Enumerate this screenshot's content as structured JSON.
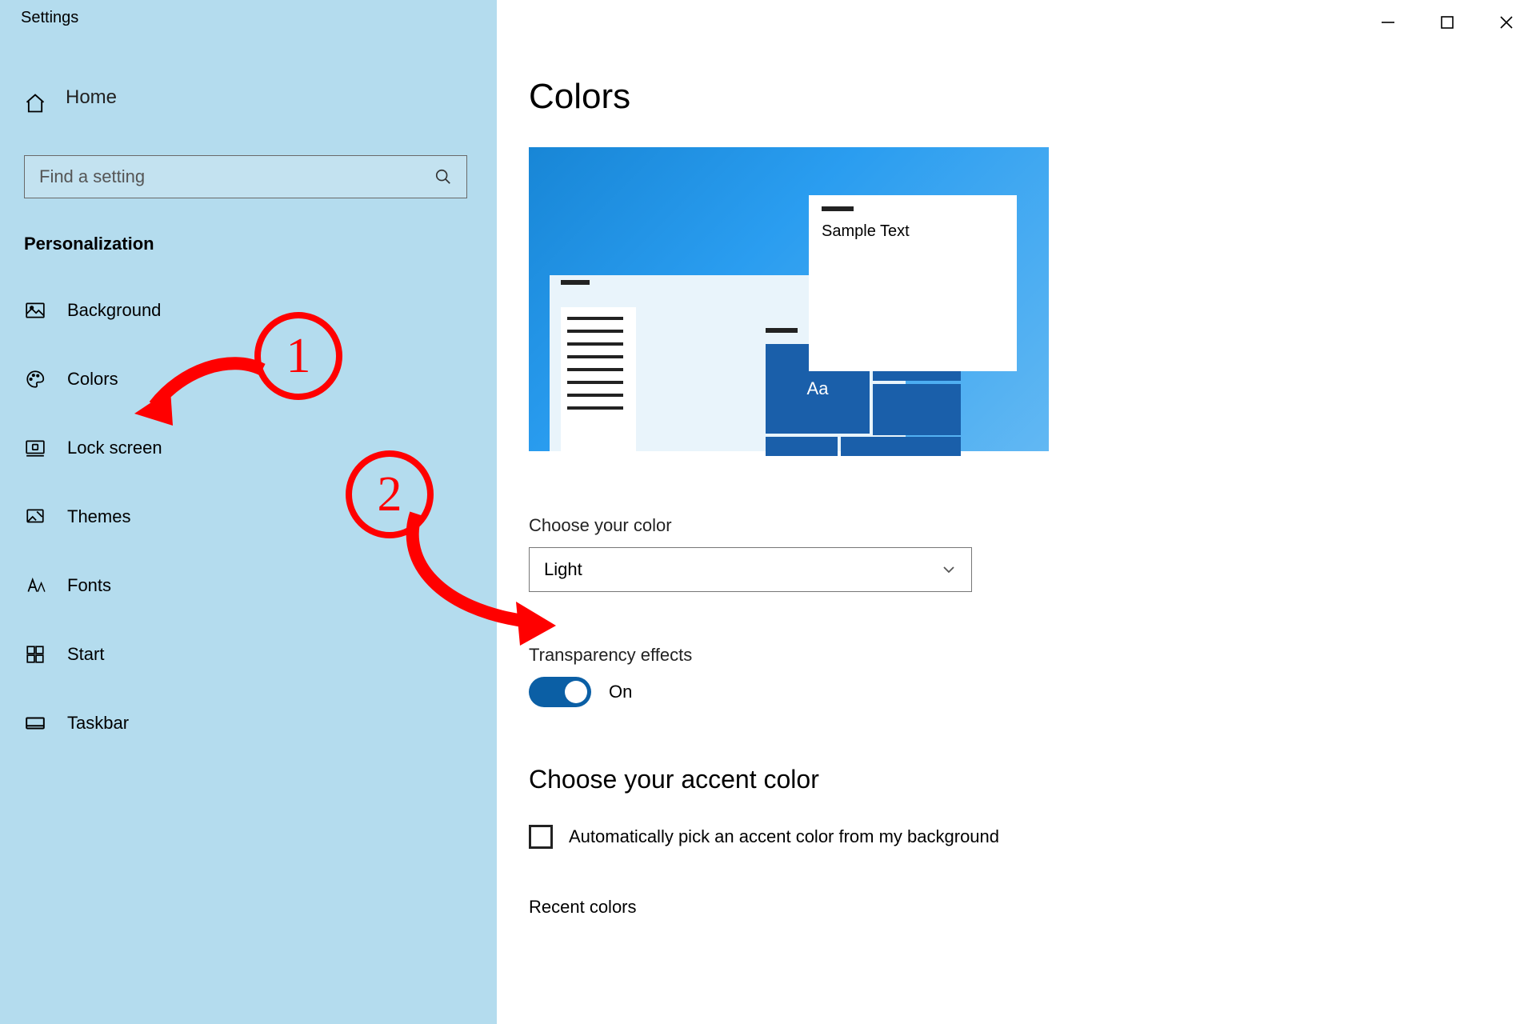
{
  "app_title": "Settings",
  "window_controls": {
    "min": "–",
    "max": "▢",
    "close": "✕"
  },
  "sidebar": {
    "home_label": "Home",
    "search_placeholder": "Find a setting",
    "section": "Personalization",
    "items": [
      {
        "id": "background",
        "label": "Background"
      },
      {
        "id": "colors",
        "label": "Colors"
      },
      {
        "id": "lock-screen",
        "label": "Lock screen"
      },
      {
        "id": "themes",
        "label": "Themes"
      },
      {
        "id": "fonts",
        "label": "Fonts"
      },
      {
        "id": "start",
        "label": "Start"
      },
      {
        "id": "taskbar",
        "label": "Taskbar"
      }
    ]
  },
  "page": {
    "title": "Colors",
    "preview": {
      "sample_text": "Sample Text",
      "tile_text": "Aa"
    },
    "choose_color": {
      "label": "Choose your color",
      "value": "Light"
    },
    "transparency": {
      "label": "Transparency effects",
      "state_label": "On",
      "on": true
    },
    "accent": {
      "heading": "Choose your accent color",
      "auto_checkbox": {
        "checked": false,
        "label": "Automatically pick an accent color from my background"
      },
      "recent_label": "Recent colors"
    }
  },
  "annotations": {
    "step1": "1",
    "step2": "2"
  },
  "colors": {
    "sidebar_bg": "#b4dcee",
    "accent_blue": "#0b5fa5",
    "preview_tile": "#1a5faa",
    "annotation": "#ff0000"
  }
}
